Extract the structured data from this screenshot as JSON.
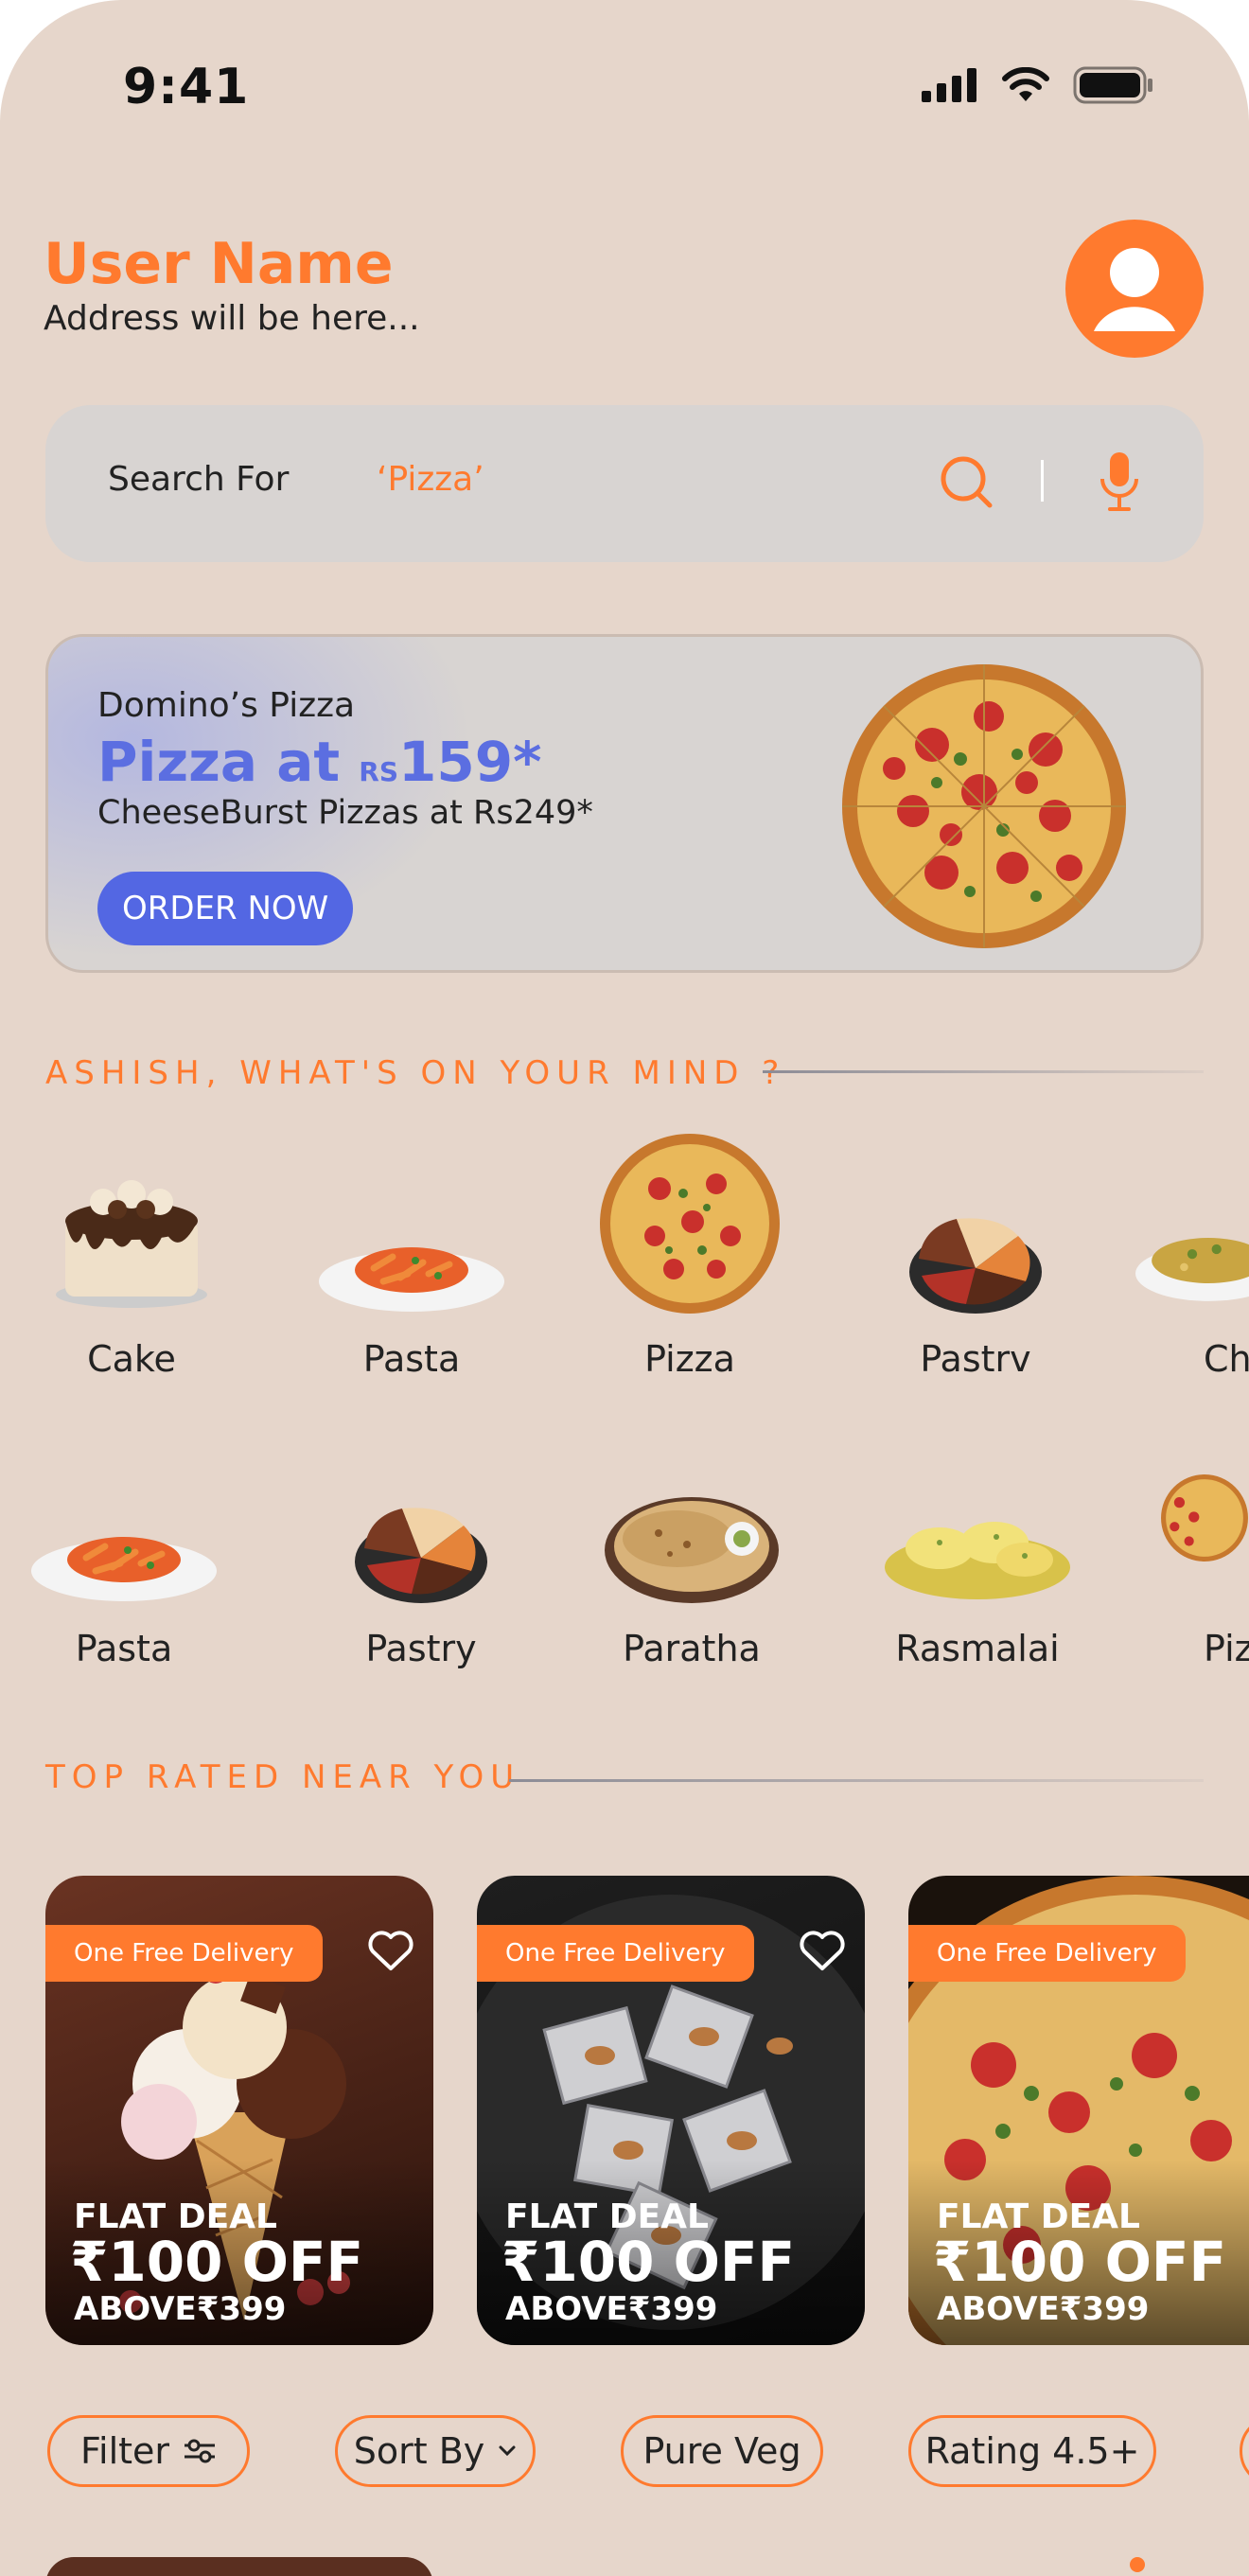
{
  "status_bar": {
    "time": "9:41"
  },
  "header": {
    "user_name": "User Name",
    "address": "Address will be here..."
  },
  "search": {
    "label": "Search For",
    "value": "‘Pizza’"
  },
  "banner": {
    "brand": "Domino’s Pizza",
    "headline_prefix": "Pizza at ",
    "headline_currency": "RS",
    "headline_price": "159*",
    "subtitle": "CheeseBurst Pizzas at Rs249*",
    "button": "ORDER NOW"
  },
  "mind_section": {
    "title": "ASHISH, WHAT'S ON YOUR MIND  ?",
    "row1": [
      "Cake",
      "Pasta",
      "Pizza",
      "Pastrv",
      "Ch"
    ],
    "row2": [
      "Pasta",
      "Pastry",
      "Paratha",
      "Rasmalai",
      "Piz"
    ]
  },
  "top_rated": {
    "title": "TOP RATED NEAR YOU",
    "cards": [
      {
        "badge": "One Free Delivery",
        "deal_line1": "FLAT DEAL",
        "deal_line2": "₹100 OFF",
        "deal_line3": "ABOVE₹399"
      },
      {
        "badge": "One Free Delivery",
        "deal_line1": "FLAT DEAL",
        "deal_line2": "₹100 OFF",
        "deal_line3": "ABOVE₹399"
      },
      {
        "badge": "One Free Delivery",
        "deal_line1": "FLAT DEAL",
        "deal_line2": "₹100 OFF",
        "deal_line3": "ABOVE₹399"
      }
    ]
  },
  "filters": {
    "filter": "Filter",
    "sort_by": "Sort By",
    "pure_veg": "Pure Veg",
    "rating": "Rating 4.5+"
  },
  "colors": {
    "accent": "#ff7a2e",
    "background": "#e6d6cb",
    "banner_blue": "#5367e3"
  }
}
